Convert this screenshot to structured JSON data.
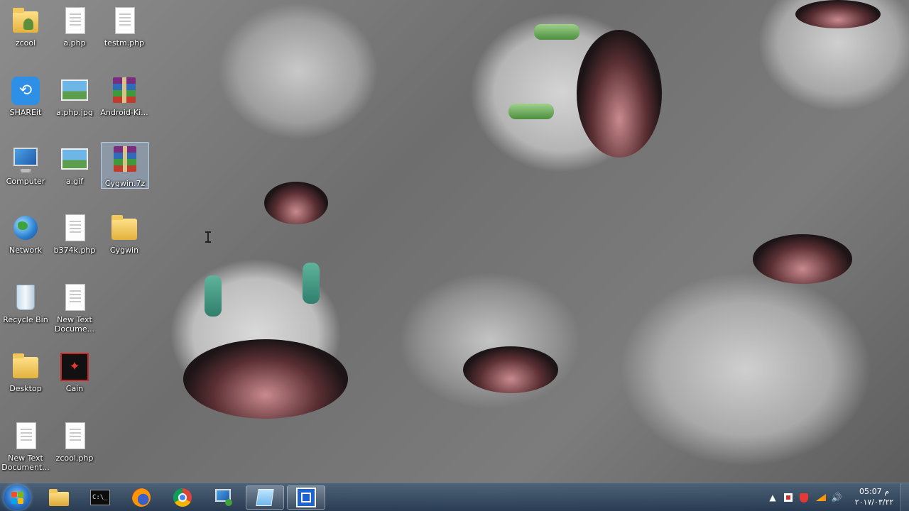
{
  "desktop": {
    "icons": [
      {
        "label": "zcool",
        "icon": "user-folder-icon"
      },
      {
        "label": "a.php",
        "icon": "document-icon"
      },
      {
        "label": "testm.php",
        "icon": "document-icon"
      },
      {
        "label": "SHAREit",
        "icon": "shareit-icon"
      },
      {
        "label": "a.php.jpg",
        "icon": "image-icon"
      },
      {
        "label": "Android-Ki...",
        "icon": "winrar-archive-icon"
      },
      {
        "label": "Computer",
        "icon": "computer-icon"
      },
      {
        "label": "a.gif",
        "icon": "image-icon"
      },
      {
        "label": "Cygwin.7z",
        "icon": "winrar-archive-icon"
      },
      {
        "label": "Network",
        "icon": "network-icon"
      },
      {
        "label": "b374k.php",
        "icon": "document-icon"
      },
      {
        "label": "Cygwin",
        "icon": "folder-icon"
      },
      {
        "label": "Recycle Bin",
        "icon": "recycle-bin-icon"
      },
      {
        "label": "New Text Docume...",
        "icon": "text-document-icon"
      },
      {
        "label": "Desktop",
        "icon": "folder-icon"
      },
      {
        "label": "Cain",
        "icon": "cain-icon"
      },
      {
        "label": "New Text Document...",
        "icon": "text-document-icon"
      },
      {
        "label": "zcool.php",
        "icon": "document-icon"
      }
    ]
  },
  "taskbar": {
    "start_icon": "windows-start-icon",
    "pinned": [
      {
        "name": "file-explorer",
        "icon": "folder-icon"
      },
      {
        "name": "command-prompt",
        "icon": "terminal-icon"
      },
      {
        "name": "firefox",
        "icon": "firefox-icon"
      },
      {
        "name": "chrome",
        "icon": "chrome-icon"
      },
      {
        "name": "network-app",
        "icon": "computer-network-icon"
      },
      {
        "name": "notepad",
        "icon": "notepad-icon"
      },
      {
        "name": "active-window",
        "icon": "window-app-icon"
      }
    ],
    "tray": {
      "icons": [
        "show-hidden-icons",
        "flag-icon",
        "security-icon",
        "network-icon",
        "volume-icon"
      ],
      "clock_time": "05:07 م",
      "clock_date": "٢٠١٧/٠٣/٢٢"
    }
  },
  "colors": {
    "taskbar": "#2f4a66",
    "label_text": "#ffffff",
    "start_orb": "#2a6fc2"
  }
}
